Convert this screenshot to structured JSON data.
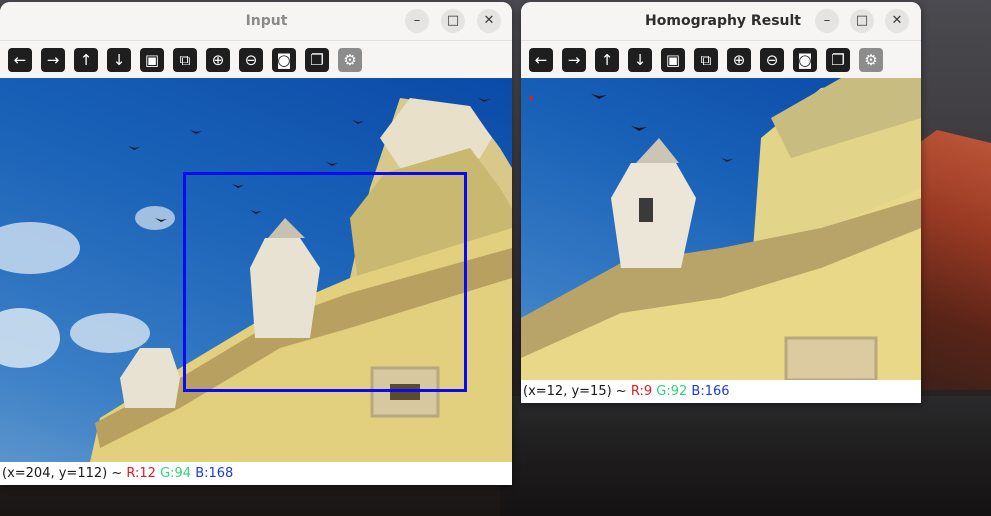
{
  "windows": {
    "input": {
      "title": "Input",
      "status": {
        "coords": "(x=204, y=112) ~ ",
        "r": "R:12",
        "g": "G:94",
        "b": "B:168"
      }
    },
    "result": {
      "title": "Homography Result",
      "status": {
        "coords": "(x=12, y=15) ~ ",
        "r": "R:9",
        "g": "G:92",
        "b": "B:166"
      }
    }
  },
  "window_controls": {
    "minimize": "–",
    "maximize": "□",
    "close": "✕"
  },
  "toolbar_icons": [
    "arrow-left-icon",
    "arrow-right-icon",
    "arrow-up-icon",
    "arrow-down-icon",
    "image-icon",
    "image-edit-icon",
    "zoom-in-icon",
    "zoom-out-icon",
    "save-icon",
    "clipboard-icon",
    "properties-icon"
  ],
  "toolbar_glyphs": {
    "left": "←",
    "right": "→",
    "up": "↑",
    "down": "↓",
    "image": "▣",
    "image_edit": "⧉",
    "zoom_in": "⊕",
    "zoom_out": "⊖",
    "save": "◙",
    "clipboard": "❐",
    "properties": "⚙"
  },
  "colors": {
    "selection_rect": "#0a0af5",
    "marker": "#e01b24"
  }
}
